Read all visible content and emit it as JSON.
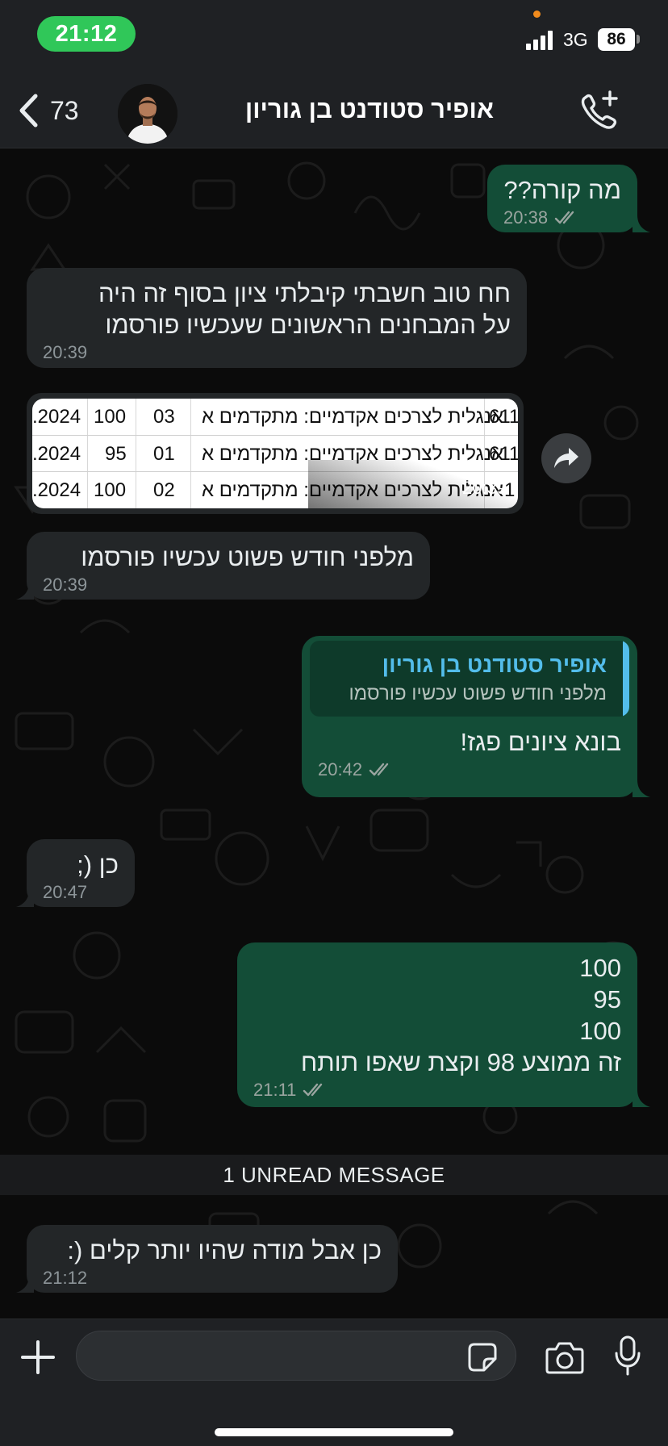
{
  "status_bar": {
    "time": "21:12",
    "network": "3G",
    "battery": "86"
  },
  "header": {
    "back_count": "73",
    "contact_name": "אופיר  סטודנט בן גוריון"
  },
  "messages": [
    {
      "text": "מה קורה??",
      "time": "20:38"
    },
    {
      "text": "חח טוב חשבתי קיבלתי ציון בסוף זה היה\nעל המבחנים הראשונים שעכשיו פורסמו",
      "time": "20:39"
    },
    {
      "text": "מלפני חודש פשוט עכשיו פורסמו",
      "time": "20:39"
    },
    {
      "quote_name": "אופיר  סטודנט בן גוריון",
      "quote_text": "מלפני חודש פשוט עכשיו פורסמו",
      "text": "בונא ציונים פגז!",
      "time": "20:42"
    },
    {
      "text": "כן (;",
      "time": "20:47"
    },
    {
      "text": "100\n95\n100\nזה ממוצע 98 וקצת שאפו תותח",
      "time": "21:11"
    },
    {
      "text": "כן אבל מודה שהיו יותר קלים (:",
      "time": "21:12"
    }
  ],
  "image_message": {
    "time": "20:39",
    "rows": [
      {
        "code": "611",
        "course": "אנגלית לצרכים אקדמיים: מתקדמים א",
        "group": "03",
        "grade": "100",
        "date": ".2024"
      },
      {
        "code": "611",
        "course": "אנגלית לצרכים אקדמיים: מתקדמים א",
        "group": "01",
        "grade": "95",
        "date": ".2024"
      },
      {
        "code": "1",
        "course": "אנגלית לצרכים אקדמיים: מתקדמים א",
        "group": "02",
        "grade": "100",
        "date": ".2024"
      }
    ]
  },
  "unread_banner": "1 UNREAD MESSAGE",
  "input": {
    "placeholder": ""
  },
  "colors": {
    "outgoing_bubble": "#134d37",
    "incoming_bubble": "#232628",
    "accent_green": "#30c759",
    "quote_blue": "#53bdeb"
  }
}
